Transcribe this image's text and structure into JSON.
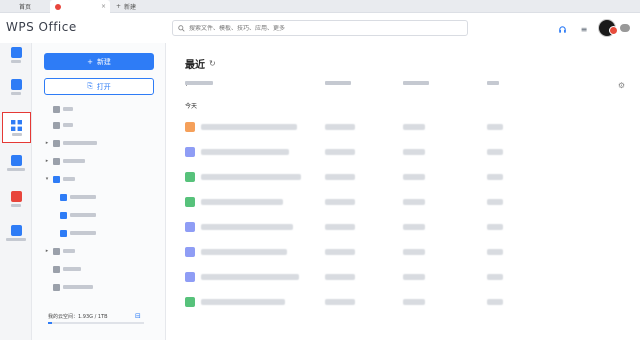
{
  "tabs": {
    "home": "首页",
    "doc": "",
    "new": "新建"
  },
  "header": {
    "logo": "WPS Office",
    "search_placeholder": "搜索文件、模板、技巧、应用、更多"
  },
  "rail": {
    "tooltip": "应用"
  },
  "nav": {
    "new_label": "新建",
    "open_label": "打开",
    "storage_text": "我的云空间：1.93G / 1TB"
  },
  "main": {
    "title": "最近",
    "group": "今天"
  },
  "colors": {
    "accent": "#2e7cf6",
    "highlight_box": "#e53935"
  },
  "files": [
    {
      "icon_color": "#f5a05a"
    },
    {
      "icon_color": "#8f9df5"
    },
    {
      "icon_color": "#57c27b"
    },
    {
      "icon_color": "#57c27b"
    },
    {
      "icon_color": "#8f9df5"
    },
    {
      "icon_color": "#8f9df5"
    },
    {
      "icon_color": "#8f9df5"
    },
    {
      "icon_color": "#57c27b"
    }
  ]
}
